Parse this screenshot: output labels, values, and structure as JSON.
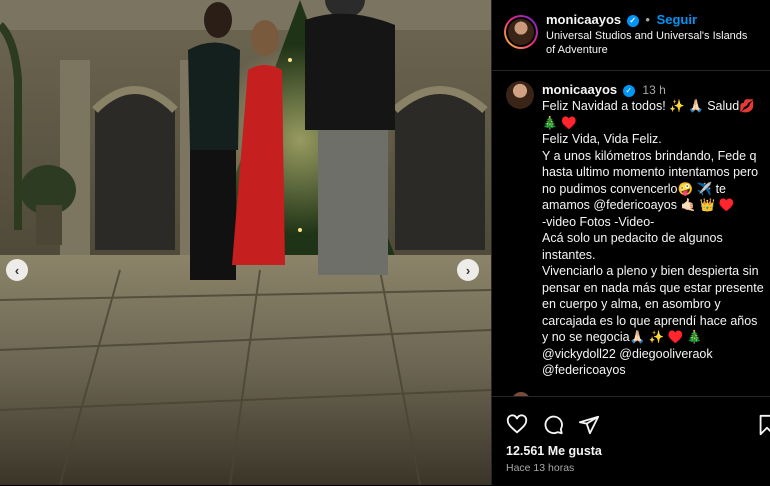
{
  "header": {
    "username": "monicaayos",
    "separator": "•",
    "follow_label": "Seguir",
    "location": "Universal Studios and Universal's Islands of Adventure",
    "more_label": "⋯"
  },
  "caption": {
    "username": "monicaayos",
    "time": "13 h",
    "text": "Feliz Navidad a todos! ✨ 🙏🏻 Salud💋\n🎄 ♥️\nFeliz Vida, Vida Feliz.\nY a unos kilómetros brindando, Fede q hasta ultimo momento intentamos pero no pudimos convencerlo🤪 ✈️ te amamos @federicoayos 🤙🏻 👑 ♥️\n-video Fotos -Video-\nAcá solo un pedacito de algunos instantes.\nVivenciarlo a pleno y bien despierta sin pensar en nada más que estar presente en cuerpo y alma, en asombro y carcajada es lo que aprendí hace años y no se negocia🙏🏻 ✨ ♥️ 🎄\n@vickydoll22 @diegooliveraok\n@federicoayos"
  },
  "carousel": {
    "prev": "‹",
    "next": "›"
  },
  "actions": {
    "likes": "12.561 Me gusta",
    "time_ago": "Hace 13 horas"
  },
  "icons": [
    "heart-icon",
    "comment-icon",
    "share-icon",
    "bookmark-icon",
    "verified-icon",
    "chevron-left-icon",
    "chevron-right-icon"
  ]
}
